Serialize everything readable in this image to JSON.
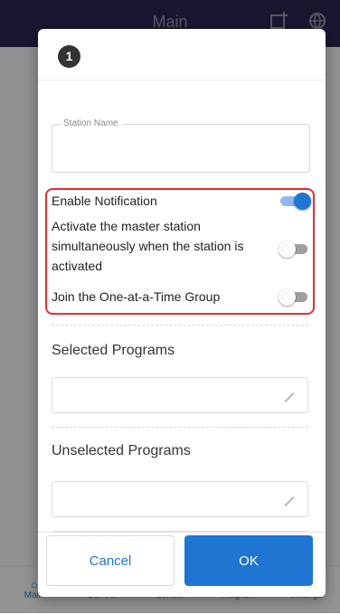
{
  "app": {
    "title": "Main",
    "nav": [
      {
        "label": "Main",
        "icon": "home-icon",
        "active": true
      },
      {
        "label": "Control",
        "icon": "control-icon",
        "active": false
      },
      {
        "label": "Sensor",
        "icon": "sensor-icon",
        "active": false
      },
      {
        "label": "Program",
        "icon": "program-icon",
        "active": false
      },
      {
        "label": "Settings",
        "icon": "settings-icon",
        "active": false
      }
    ]
  },
  "dialog": {
    "station_number": "1",
    "station_name": {
      "label": "Station Name",
      "value": ""
    },
    "options": [
      {
        "label": "Enable Notification",
        "enabled": true
      },
      {
        "label": "Activate the master station simultaneously when the station is activated",
        "enabled": false
      },
      {
        "label": "Join the One-at-a-Time Group",
        "enabled": false
      }
    ],
    "selected_programs": {
      "title": "Selected Programs",
      "value": ""
    },
    "unselected_programs": {
      "title": "Unselected Programs",
      "values": [
        "",
        ""
      ]
    },
    "cancel_label": "Cancel",
    "ok_label": "OK"
  },
  "colors": {
    "accent": "#1f76d2",
    "highlight_border": "#e0303a",
    "header_bg": "#2b2550"
  }
}
